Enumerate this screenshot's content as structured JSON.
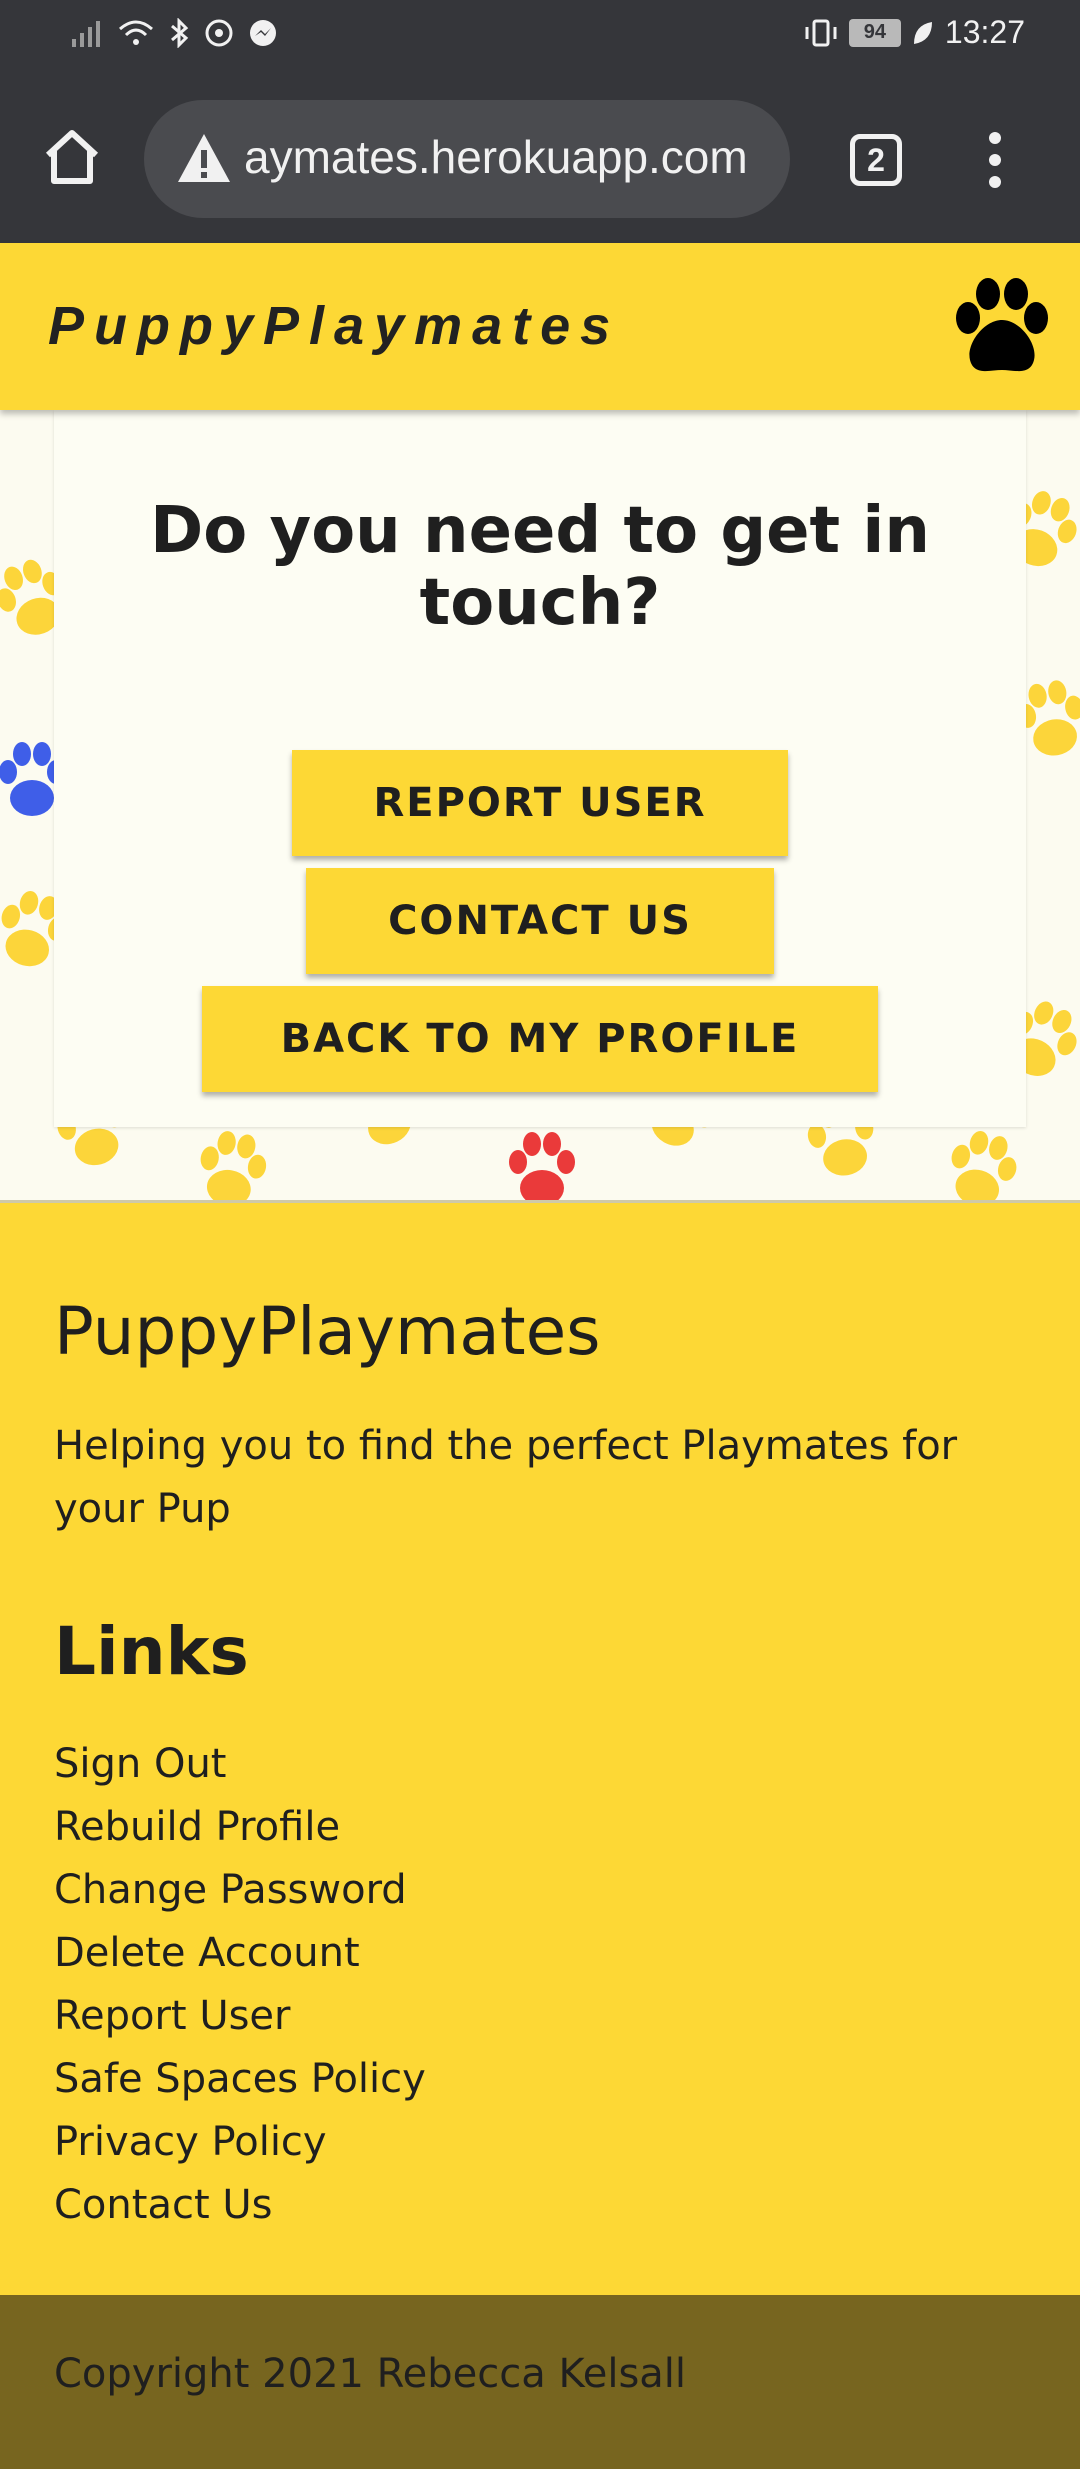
{
  "status_bar": {
    "battery": "94",
    "time": "13:27"
  },
  "browser": {
    "url": "aymates.herokuapp.com",
    "tab_count": "2"
  },
  "header": {
    "brand": "PuppyPlaymates"
  },
  "card": {
    "title": "Do you need to get in touch?",
    "buttons": {
      "report": "REPORT USER",
      "contact": "CONTACT US",
      "back": "BACK TO MY PROFILE"
    }
  },
  "footer": {
    "title": "PuppyPlaymates",
    "description": "Helping you to find the perfect Playmates for your Pup",
    "links_title": "Links",
    "links": [
      "Sign Out",
      "Rebuild Profile",
      "Change Password",
      "Delete Account",
      "Report User",
      "Safe Spaces Policy",
      "Privacy Policy",
      "Contact Us"
    ],
    "copyright": "Copyright 2021 Rebecca Kelsall"
  },
  "colors": {
    "brand_yellow": "#fdd835",
    "copyright_bar": "#77651f",
    "paw_yellow": "#fcd53a",
    "paw_red": "#ea3a3a",
    "paw_blue": "#3f5ee8"
  }
}
